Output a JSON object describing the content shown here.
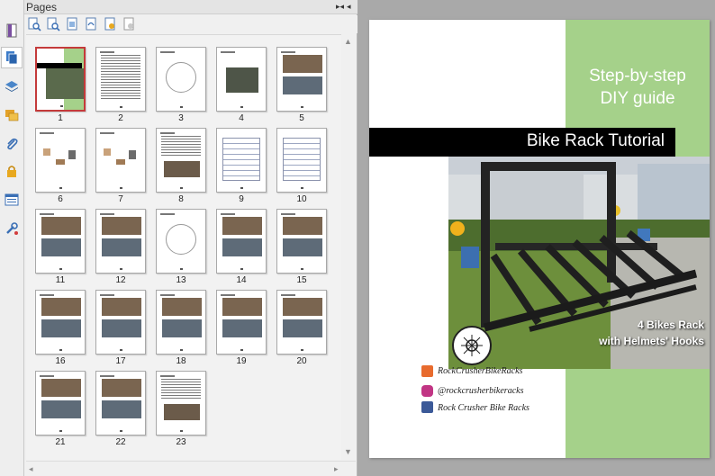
{
  "panel": {
    "title": "Pages",
    "collapse_glyph": "▸◂",
    "menu_glyph": "◂",
    "scroll_up_glyph": "▲",
    "scroll_down_glyph": "▼",
    "scroll_left_glyph": "◂",
    "scroll_right_glyph": "▸"
  },
  "thumbnails": [
    {
      "number": "1",
      "kind": "cover",
      "selected": true
    },
    {
      "number": "2",
      "kind": "text"
    },
    {
      "number": "3",
      "kind": "diagram"
    },
    {
      "number": "4",
      "kind": "photo"
    },
    {
      "number": "5",
      "kind": "photos"
    },
    {
      "number": "6",
      "kind": "parts"
    },
    {
      "number": "7",
      "kind": "parts"
    },
    {
      "number": "8",
      "kind": "text-photo"
    },
    {
      "number": "9",
      "kind": "table"
    },
    {
      "number": "10",
      "kind": "table"
    },
    {
      "number": "11",
      "kind": "photos"
    },
    {
      "number": "12",
      "kind": "photos"
    },
    {
      "number": "13",
      "kind": "diagram"
    },
    {
      "number": "14",
      "kind": "photos"
    },
    {
      "number": "15",
      "kind": "photos"
    },
    {
      "number": "16",
      "kind": "photos"
    },
    {
      "number": "17",
      "kind": "photos"
    },
    {
      "number": "18",
      "kind": "photos"
    },
    {
      "number": "19",
      "kind": "photos"
    },
    {
      "number": "20",
      "kind": "photos"
    },
    {
      "number": "21",
      "kind": "photos"
    },
    {
      "number": "22",
      "kind": "photos"
    },
    {
      "number": "23",
      "kind": "text-photo"
    }
  ],
  "document": {
    "guide_line_1": "Step-by-step",
    "guide_line_2": "DIY guide",
    "title": "Bike Rack Tutorial",
    "photo_label_1": "4 Bikes Rack",
    "photo_label_2": "with Helmets' Hooks",
    "email_text": "RockCrusherBikeRacks",
    "instagram_text": "@rockcrusherbikeracks",
    "facebook_text": "Rock Crusher Bike Racks"
  },
  "colors": {
    "accent_green": "#a5d18a",
    "selected_border": "#c43a3a",
    "title_bar": "#000000"
  }
}
